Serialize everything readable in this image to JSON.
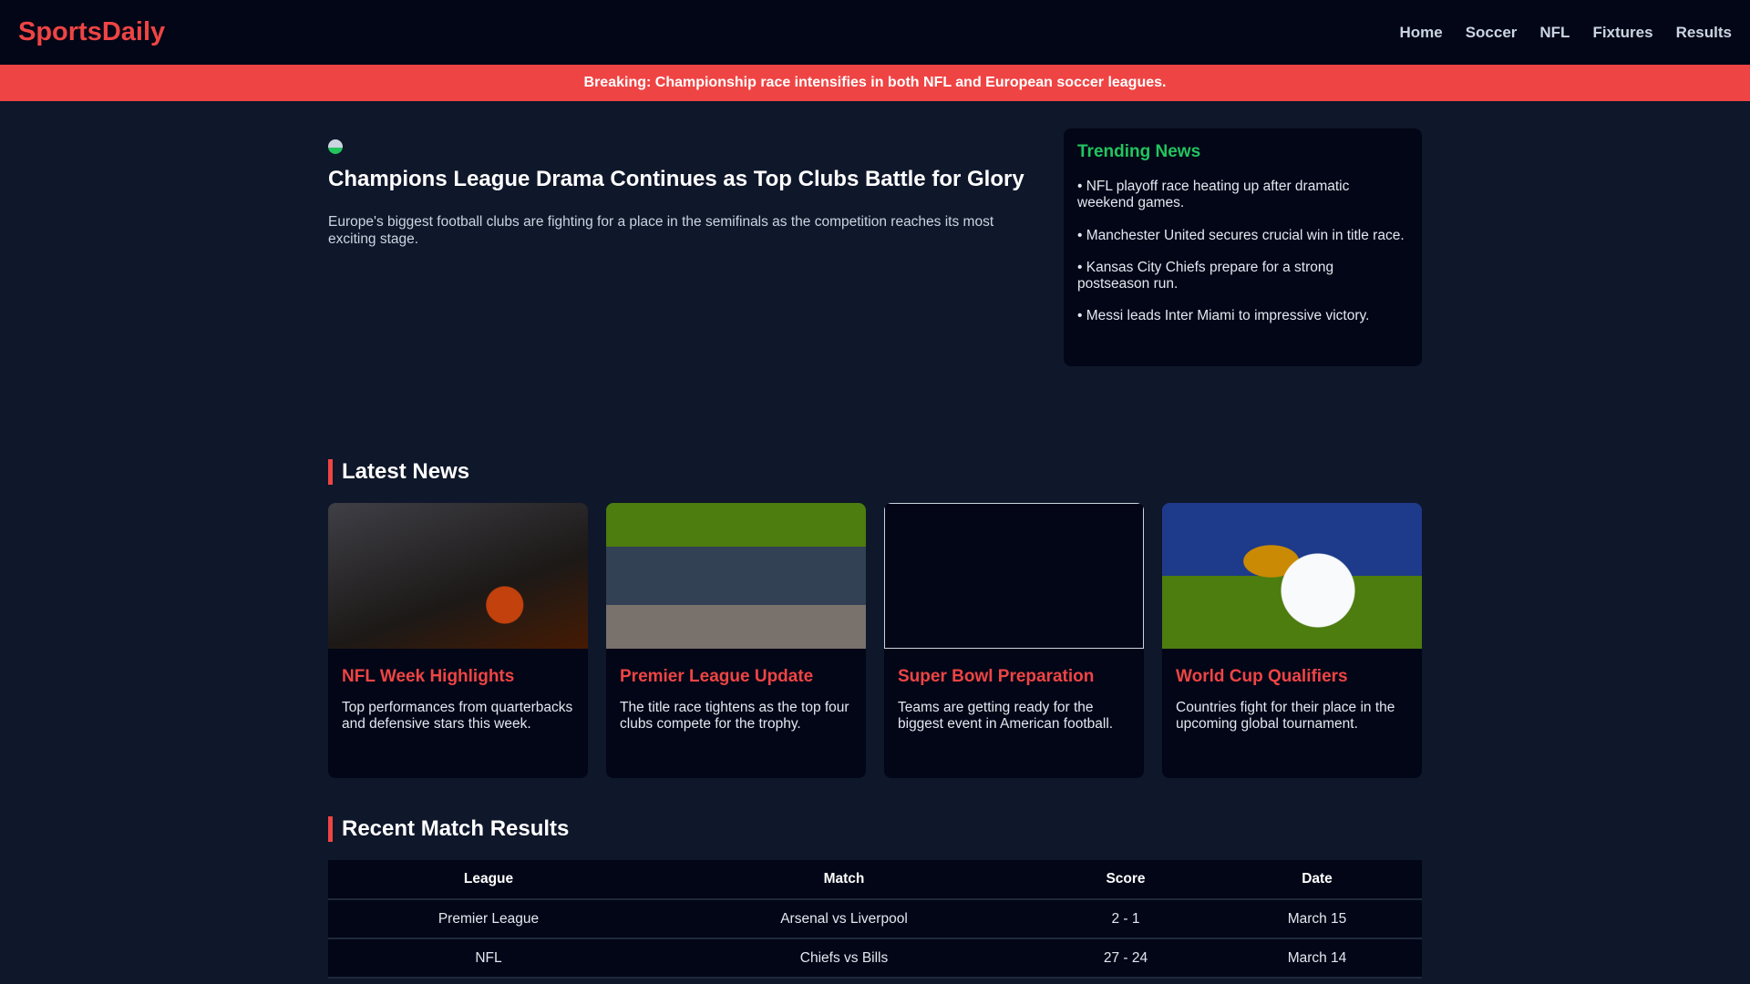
{
  "header": {
    "logo": "SportsDaily",
    "nav": [
      "Home",
      "Soccer",
      "NFL",
      "Fixtures",
      "Results"
    ]
  },
  "banner": "Breaking: Championship race intensifies in both NFL and European soccer leagues.",
  "hero": {
    "title": "Champions League Drama Continues as Top Clubs Battle for Glory",
    "text": "Europe's biggest football clubs are fighting for a place in the semifinals as the competition reaches its most exciting stage."
  },
  "trending": {
    "title": "Trending News",
    "items": [
      "• NFL playoff race heating up after dramatic weekend games.",
      "• Manchester United secures crucial win in title race.",
      "• Kansas City Chiefs prepare for a strong postseason run.",
      "• Messi leads Inter Miami to impressive victory."
    ]
  },
  "latest": {
    "title": "Latest News",
    "cards": [
      {
        "title": "NFL Week Highlights",
        "text": "Top performances from quarterbacks and defensive stars this week."
      },
      {
        "title": "Premier League Update",
        "text": "The title race tightens as the top four clubs compete for the trophy."
      },
      {
        "title": "Super Bowl Preparation",
        "text": "Teams are getting ready for the biggest event in American football."
      },
      {
        "title": "World Cup Qualifiers",
        "text": "Countries fight for their place in the upcoming global tournament."
      }
    ]
  },
  "results": {
    "title": "Recent Match Results",
    "headers": [
      "League",
      "Match",
      "Score",
      "Date"
    ],
    "rows": [
      [
        "Premier League",
        "Arsenal vs Liverpool",
        "2 - 1",
        "March 15"
      ],
      [
        "NFL",
        "Chiefs vs Bills",
        "27 - 24",
        "March 14"
      ]
    ]
  }
}
